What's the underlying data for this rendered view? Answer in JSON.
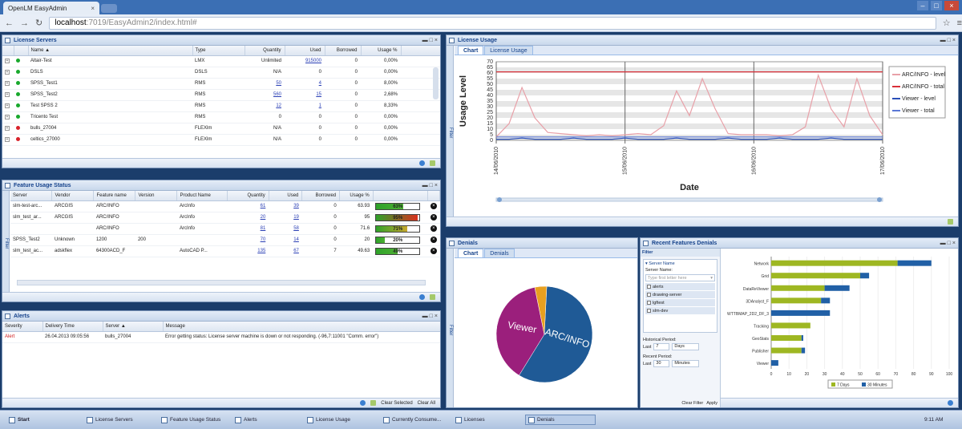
{
  "browser": {
    "tab_title": "OpenLM EasyAdmin",
    "url_host": "localhost",
    "url_path": ":7019/EasyAdmin2/index.html#"
  },
  "license_servers": {
    "title": "License Servers",
    "columns": [
      "Name",
      "Type",
      "Quantity",
      "Used",
      "Borrowed",
      "Usage %"
    ],
    "rows": [
      {
        "status": "green",
        "name": "Altair-Test",
        "type": "LMX",
        "quantity": "Unlimited",
        "used": "915000",
        "borrowed": "0",
        "usage": "0,00%"
      },
      {
        "status": "green",
        "name": "DSLS",
        "type": "DSLS",
        "quantity": "N/A",
        "used": "0",
        "borrowed": "0",
        "usage": "0,00%"
      },
      {
        "status": "green",
        "name": "SPSS_Test1",
        "type": "RMS",
        "quantity": "50",
        "used": "4",
        "borrowed": "0",
        "usage": "8,00%"
      },
      {
        "status": "green",
        "name": "SPSS_Test2",
        "type": "RMS",
        "quantity": "560",
        "used": "15",
        "borrowed": "0",
        "usage": "2,68%"
      },
      {
        "status": "green",
        "name": "Test SPSS 2",
        "type": "RMS",
        "quantity": "12",
        "used": "1",
        "borrowed": "0",
        "usage": "8,33%"
      },
      {
        "status": "green",
        "name": "Tricento Test",
        "type": "RMS",
        "quantity": "0",
        "used": "0",
        "borrowed": "0",
        "usage": "0,00%"
      },
      {
        "status": "red",
        "name": "bulls_27004",
        "type": "FLEXlm",
        "quantity": "N/A",
        "used": "0",
        "borrowed": "0",
        "usage": "0,00%"
      },
      {
        "status": "red",
        "name": "celtics_27000",
        "type": "FLEXlm",
        "quantity": "N/A",
        "used": "0",
        "borrowed": "0",
        "usage": "0,00%"
      }
    ]
  },
  "feature_usage": {
    "title": "Feature Usage Status",
    "filter_label": "Filter",
    "columns": [
      "Server",
      "Vendor",
      "Feature name",
      "Version",
      "Product Name",
      "Quantity",
      "Used",
      "Borrowed",
      "Usage %"
    ],
    "rows": [
      {
        "server": "slm-test-arc...",
        "vendor": "ARCGIS",
        "feature": "ARC/INFO",
        "version": "",
        "product": "ArcInfo",
        "quantity": "61",
        "used": "39",
        "borrowed": "0",
        "usage": "63.93",
        "bar_label": "63%",
        "fill": 0.63,
        "fill_color": "#4caf32"
      },
      {
        "server": "slm_test_ar...",
        "vendor": "ARCGIS",
        "feature": "ARC/INFO",
        "version": "",
        "product": "ArcInfo",
        "quantity": "20",
        "used": "19",
        "borrowed": "0",
        "usage": "95",
        "bar_label": "95%",
        "fill": 0.95,
        "fill_color": "#d9301e"
      },
      {
        "server": "",
        "vendor": "",
        "feature": "ARC/INFO",
        "version": "",
        "product": "ArcInfo",
        "quantity": "81",
        "used": "58",
        "borrowed": "0",
        "usage": "71.6",
        "bar_label": "71%",
        "fill": 0.71,
        "fill_color": "#c8a82e"
      },
      {
        "server": "SPSS_Test2",
        "vendor": "Unknown",
        "feature": "1200",
        "version": "200",
        "product": "",
        "quantity": "70",
        "used": "14",
        "borrowed": "0",
        "usage": "20",
        "bar_label": "20%",
        "fill": 0.2,
        "fill_color": "#4caf32"
      },
      {
        "server": "slm_test_ac...",
        "vendor": "adskflex",
        "feature": "64300ACD_F",
        "version": "",
        "product": "AutoCAD P...",
        "quantity": "135",
        "used": "67",
        "borrowed": "7",
        "usage": "49.63",
        "bar_label": "49%",
        "fill": 0.49,
        "fill_color": "#4caf32"
      }
    ]
  },
  "alerts": {
    "title": "Alerts",
    "columns": [
      "Severity",
      "Delivery Time",
      "Server",
      "Message"
    ],
    "rows": [
      {
        "severity": "Alert",
        "time": "26.04.2013 09:05:56",
        "server": "bulls_27004",
        "message": "Error getting status: License server machine is down or not responding. (-96,7:11001 \"Comm. error\")"
      }
    ],
    "clear_selected": "Clear Selected",
    "clear_all": "Clear All"
  },
  "license_usage": {
    "title": "License Usage",
    "filter_label": "Filter",
    "tabs": [
      "Chart",
      "License Usage"
    ]
  },
  "denials": {
    "title": "Denials",
    "filter_label": "Filter",
    "tabs": [
      "Chart",
      "Denials"
    ]
  },
  "recent_features": {
    "title": "Recent Features Denials",
    "filter_title": "Filter",
    "server_name_header": "Server Name",
    "server_name_label": "Server Name:",
    "server_search_placeholder": "Type first letter here",
    "servers": [
      "alerts",
      "drawing-server",
      "lgftest",
      "slm-dev"
    ],
    "historical_label": "Historical Period:",
    "historical_prefix": "Last",
    "historical_value": "7",
    "historical_unit": "Days",
    "recent_label": "Recent Period:",
    "recent_prefix": "Last",
    "recent_value": "30",
    "recent_unit": "Minutes",
    "clear_filter": "Clear Filter",
    "apply": "Apply"
  },
  "taskbar": {
    "start": "Start",
    "items": [
      "License Servers",
      "Feature Usage Status",
      "Alerts",
      "License Usage",
      "Currently Consume...",
      "Licenses",
      "Denials"
    ],
    "clock": "9:11 AM"
  },
  "chart_data": [
    {
      "type": "line",
      "xlabel": "Date",
      "ylabel": "Usage Level",
      "ylim": [
        0,
        70
      ],
      "yticks": [
        0,
        5,
        10,
        15,
        20,
        25,
        30,
        35,
        40,
        45,
        50,
        55,
        60,
        65,
        70
      ],
      "xticks": [
        "14/06/2010",
        "15/06/2010",
        "16/06/2010",
        "17/06/2010"
      ],
      "legend_position": "right",
      "x": [
        0,
        0.1,
        0.2,
        0.3,
        0.4,
        0.5,
        0.6,
        0.7,
        0.8,
        0.9,
        1.0,
        1.1,
        1.2,
        1.3,
        1.4,
        1.5,
        1.6,
        1.7,
        1.8,
        1.9,
        2.0,
        2.1,
        2.2,
        2.3,
        2.4,
        2.5,
        2.6,
        2.7,
        2.8,
        2.9,
        3.0
      ],
      "series": [
        {
          "name": "ARC/INFO - level",
          "color": "#e8a0a8",
          "values": [
            3,
            15,
            47,
            20,
            7,
            6,
            5,
            4,
            5,
            4,
            5,
            6,
            5,
            13,
            44,
            22,
            55,
            28,
            6,
            5,
            5,
            5,
            4,
            5,
            12,
            58,
            28,
            12,
            55,
            22,
            5
          ]
        },
        {
          "name": "ARC/INFO - total",
          "color": "#d9303a",
          "values": [
            61,
            61,
            61,
            61,
            61,
            61,
            61,
            61,
            61,
            61,
            61,
            61,
            61,
            61,
            61,
            61,
            61,
            61,
            61,
            61,
            61,
            61,
            61,
            61,
            61,
            61,
            61,
            61,
            61,
            61,
            61
          ]
        },
        {
          "name": "Viewer - level",
          "color": "#2a4fb8",
          "values": [
            1,
            1,
            2,
            1,
            1,
            1,
            2,
            1,
            1,
            1,
            2,
            1,
            1,
            1,
            2,
            1,
            1,
            1,
            2,
            1,
            1,
            1,
            2,
            1,
            1,
            1,
            2,
            1,
            1,
            1,
            1
          ]
        },
        {
          "name": "Viewer - total",
          "color": "#5b78d6",
          "values": [
            3,
            3,
            3,
            3,
            3,
            3,
            3,
            3,
            3,
            3,
            3,
            3,
            3,
            3,
            3,
            3,
            3,
            3,
            3,
            3,
            3,
            3,
            3,
            3,
            3,
            3,
            3,
            3,
            3,
            3,
            3
          ]
        }
      ]
    },
    {
      "type": "pie",
      "categories": [
        "ARC/INFO",
        "Viewer",
        "Other"
      ],
      "values": [
        58,
        38,
        4
      ],
      "colors": [
        "#1f5a96",
        "#9b1f7c",
        "#e8a020"
      ]
    },
    {
      "type": "bar",
      "orientation": "horizontal",
      "categories": [
        "Network",
        "Grid",
        "DataReViewer",
        "3DAnalyst_F",
        "WTTBMAP_2D2_DF_3",
        "Tracking",
        "GeoStats",
        "Publisher",
        "Viewer"
      ],
      "xlim": [
        0,
        100
      ],
      "xticks": [
        0,
        10,
        20,
        30,
        40,
        50,
        60,
        70,
        80,
        90,
        100
      ],
      "legend_position": "bottom",
      "series": [
        {
          "name": "7 Days",
          "color": "#9eb722",
          "values": [
            71,
            50,
            30,
            28,
            0,
            22,
            17,
            17,
            0
          ]
        },
        {
          "name": "30 Minutes",
          "color": "#2160a6",
          "values": [
            19,
            5,
            14,
            5,
            33,
            0,
            1,
            2,
            4
          ]
        }
      ]
    }
  ]
}
